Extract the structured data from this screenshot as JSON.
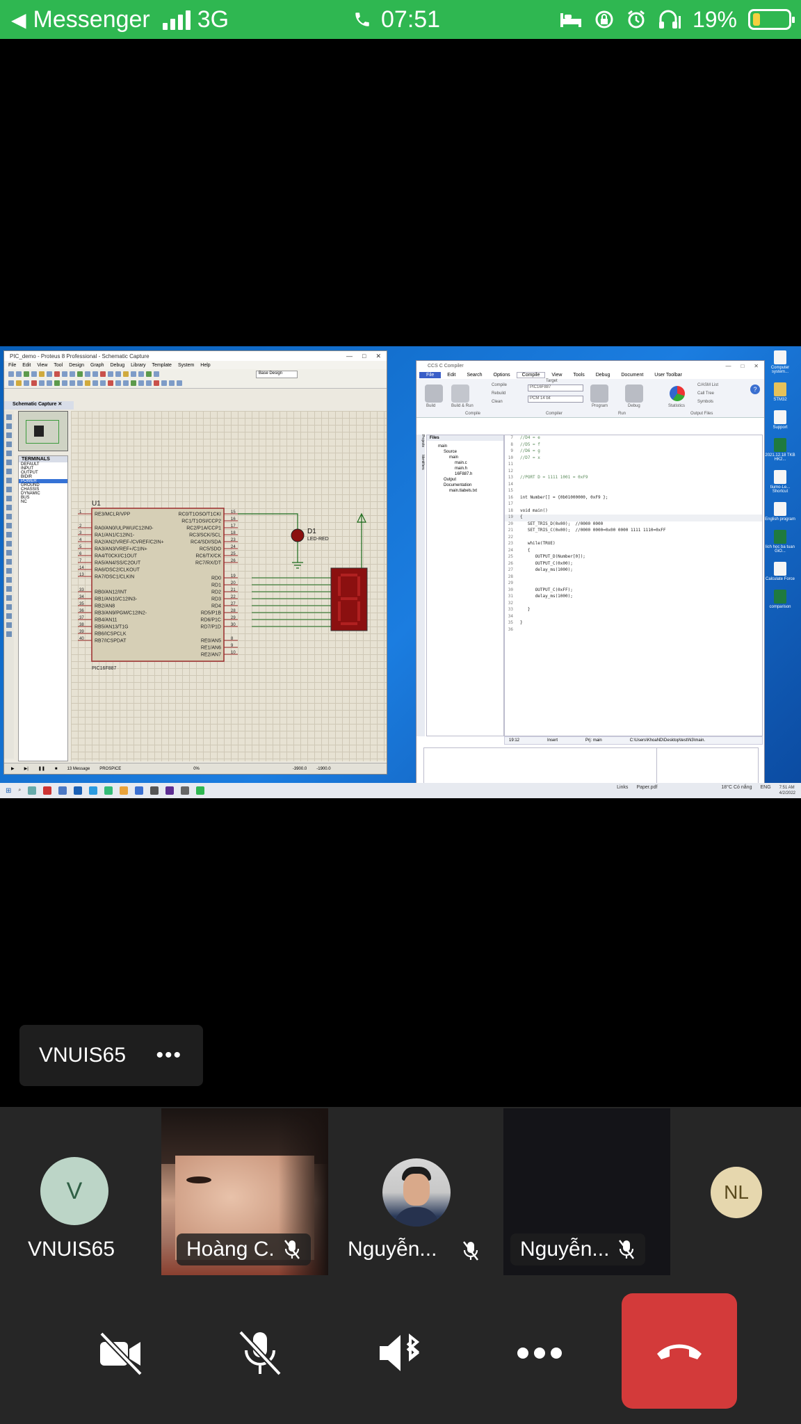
{
  "status_bar": {
    "back_app": "Messenger",
    "network": "3G",
    "time": "07:51",
    "battery": "19%",
    "battery_level": 0.19
  },
  "shared_screen": {
    "proteus": {
      "title": "PIC_demo - Proteus 8 Professional - Schematic Capture",
      "menu": [
        "File",
        "Edit",
        "View",
        "Tool",
        "Design",
        "Graph",
        "Debug",
        "Library",
        "Template",
        "System",
        "Help"
      ],
      "design_select": "Base Design",
      "tab": "Schematic Capture",
      "terminals_header": "TERMINALS",
      "terminals": [
        "DEFAULT",
        "INPUT",
        "OUTPUT",
        "BIDIR",
        "POWER",
        "GROUND",
        "CHASSIS",
        "DYNAMIC",
        "BUS",
        "NC"
      ],
      "terminals_selected": "POWER",
      "chip_ref": "U1",
      "chip_part": "PIC16F887",
      "left_pins": [
        "RE3/MCLR/VPP",
        "RA0/AN0/ULPWU/C12IN0-",
        "RA1/AN1/C12IN1-",
        "RA2/AN2/VREF-/CVREF/C2IN+",
        "RA3/AN3/VREF+/C1IN+",
        "RA4/T0CKI/C1OUT",
        "RA5/AN4/SS/C2OUT",
        "RA6/OSC2/CLKOUT",
        "RA7/OSC1/CLKIN",
        "RB0/AN12/INT",
        "RB1/AN10/C12IN3-",
        "RB2/AN8",
        "RB3/AN9/PGM/C12IN2-",
        "RB4/AN11",
        "RB5/AN13/T1G",
        "RB6/ICSPCLK",
        "RB7/ICSPDAT"
      ],
      "left_pin_numbers": [
        "1",
        "2",
        "3",
        "4",
        "5",
        "6",
        "7",
        "14",
        "13",
        "33",
        "34",
        "35",
        "36",
        "37",
        "38",
        "39",
        "40"
      ],
      "right_pins": [
        "RC0/T1OSO/T1CKI",
        "RC1/T1OSI/CCP2",
        "RC2/P1A/CCP1",
        "RC3/SCK/SCL",
        "RC4/SDI/SDA",
        "RC5/SDO",
        "RC6/TX/CK",
        "RC7/RX/DT",
        "RD0",
        "RD1",
        "RD2",
        "RD3",
        "RD4",
        "RD5/P1B",
        "RD6/P1C",
        "RD7/P1D",
        "RE0/AN5",
        "RE1/AN6",
        "RE2/AN7"
      ],
      "right_pin_numbers": [
        "15",
        "16",
        "17",
        "18",
        "23",
        "24",
        "25",
        "26",
        "19",
        "20",
        "21",
        "22",
        "27",
        "28",
        "29",
        "30",
        "8",
        "9",
        "10"
      ],
      "led_ref": "D1",
      "led_part": "LED-RED",
      "status_messages": "13 Message",
      "status_sim": "PROSPICE",
      "status_progress": "0%",
      "status_x": "-3900.0",
      "status_y": "-1900.0"
    },
    "ccs": {
      "title": "CCS C Compiler",
      "tabs": [
        "File",
        "Edit",
        "Search",
        "Options",
        "Compile",
        "View",
        "Tools",
        "Debug",
        "Document",
        "User Toolbar"
      ],
      "active_tab": "Compile",
      "ribbon_groups": [
        "Compile",
        "Compiler",
        "Run",
        "Output Files"
      ],
      "ribbon_buttons": [
        "Build",
        "Build & Run",
        "Compile",
        "Rebuild",
        "Clean",
        "Program",
        "Debug",
        "Statistics",
        "C/ASM List",
        "Call Tree",
        "Symbols"
      ],
      "target_label": "Target",
      "target_value": "PIC16F887",
      "compiler_value": "PCM 14 bit",
      "files_header": "Files",
      "tree": [
        "main",
        "Source",
        "main",
        "main.c",
        "main.h",
        "16F887.h",
        "Output",
        "Documentation",
        "main.tlabels.txt"
      ],
      "side_tabs": [
        "Projects",
        "Identifiers"
      ],
      "code_lines": [
        {
          "n": "7",
          "t": "//D4 = e",
          "c": true
        },
        {
          "n": "8",
          "t": "//D5 = f",
          "c": true
        },
        {
          "n": "9",
          "t": "//D6 = g",
          "c": true
        },
        {
          "n": "10",
          "t": "//D7 = x",
          "c": true
        },
        {
          "n": "11",
          "t": "",
          "c": false
        },
        {
          "n": "12",
          "t": "",
          "c": false
        },
        {
          "n": "13",
          "t": "//PORT D = 1111 1001 = 0xF9",
          "c": true
        },
        {
          "n": "14",
          "t": "",
          "c": false
        },
        {
          "n": "15",
          "t": "",
          "c": false
        },
        {
          "n": "16",
          "t": "int Number[] = {0b01000000, 0xF9 };",
          "c": false
        },
        {
          "n": "17",
          "t": "",
          "c": false
        },
        {
          "n": "18",
          "t": "void main()",
          "c": false
        },
        {
          "n": "19",
          "t": "{",
          "c": false
        },
        {
          "n": "20",
          "t": "   SET_TRIS_D(0x00);  //0000 0000",
          "c": false
        },
        {
          "n": "21",
          "t": "   SET_TRIS_C(0x00);  //0000 0000=0x00 0000 1111 1110=0xFF",
          "c": false
        },
        {
          "n": "22",
          "t": "",
          "c": false
        },
        {
          "n": "23",
          "t": "   while(TRUE)",
          "c": false
        },
        {
          "n": "24",
          "t": "   {",
          "c": false
        },
        {
          "n": "25",
          "t": "      OUTPUT_D(Number[0]);",
          "c": false
        },
        {
          "n": "26",
          "t": "      OUTPUT_C(0x00);",
          "c": false
        },
        {
          "n": "27",
          "t": "      delay_ms(1000);",
          "c": false
        },
        {
          "n": "28",
          "t": "",
          "c": false
        },
        {
          "n": "29",
          "t": "",
          "c": false
        },
        {
          "n": "30",
          "t": "      OUTPUT_C(0xFF);",
          "c": false
        },
        {
          "n": "31",
          "t": "      delay_ms(1000);",
          "c": false
        },
        {
          "n": "32",
          "t": "",
          "c": false
        },
        {
          "n": "33",
          "t": "   }",
          "c": false
        },
        {
          "n": "34",
          "t": "",
          "c": false
        },
        {
          "n": "35",
          "t": "}",
          "c": false
        },
        {
          "n": "36",
          "t": "",
          "c": false
        }
      ],
      "status_pos": "19:12",
      "status_mode": "Insert",
      "status_project": "Prj: main",
      "status_path": "C:\\Users\\KhoaND\\Desktop\\test\\N3\\main."
    },
    "desktop_icons": [
      "Computer system...",
      "STM32",
      "Support",
      "2021.12.18 TKB HK2...",
      "tiumo-Le... Shortcut",
      "English program",
      "lich hoc ba tuan GiO...",
      "Calculate Force",
      "comparison"
    ],
    "taskbar": {
      "links": "Links",
      "paper": "Paper.pdf",
      "weather": "18°C Có nắng",
      "lang": "ENG",
      "clock_time": "7:51 AM",
      "clock_date": "4/2/2022"
    }
  },
  "presenter_label": "VNUIS65",
  "participants": [
    {
      "name": "VNUIS65",
      "initial": "V",
      "muted": false
    },
    {
      "name": "Hoàng C.",
      "muted": true
    },
    {
      "name": "Nguyễn...",
      "muted": true
    },
    {
      "name": "Nguyễn...",
      "muted": true
    },
    {
      "name": "NL",
      "initial": "NL",
      "muted": false
    }
  ],
  "colors": {
    "status_bar": "#2fb751",
    "end_call": "#d33a3a",
    "avatar_v_bg": "#bcd5c7",
    "avatar_v_fg": "#2f5f45",
    "avatar_nl_bg": "#e6d7ae",
    "avatar_nl_fg": "#5a4a1e"
  }
}
